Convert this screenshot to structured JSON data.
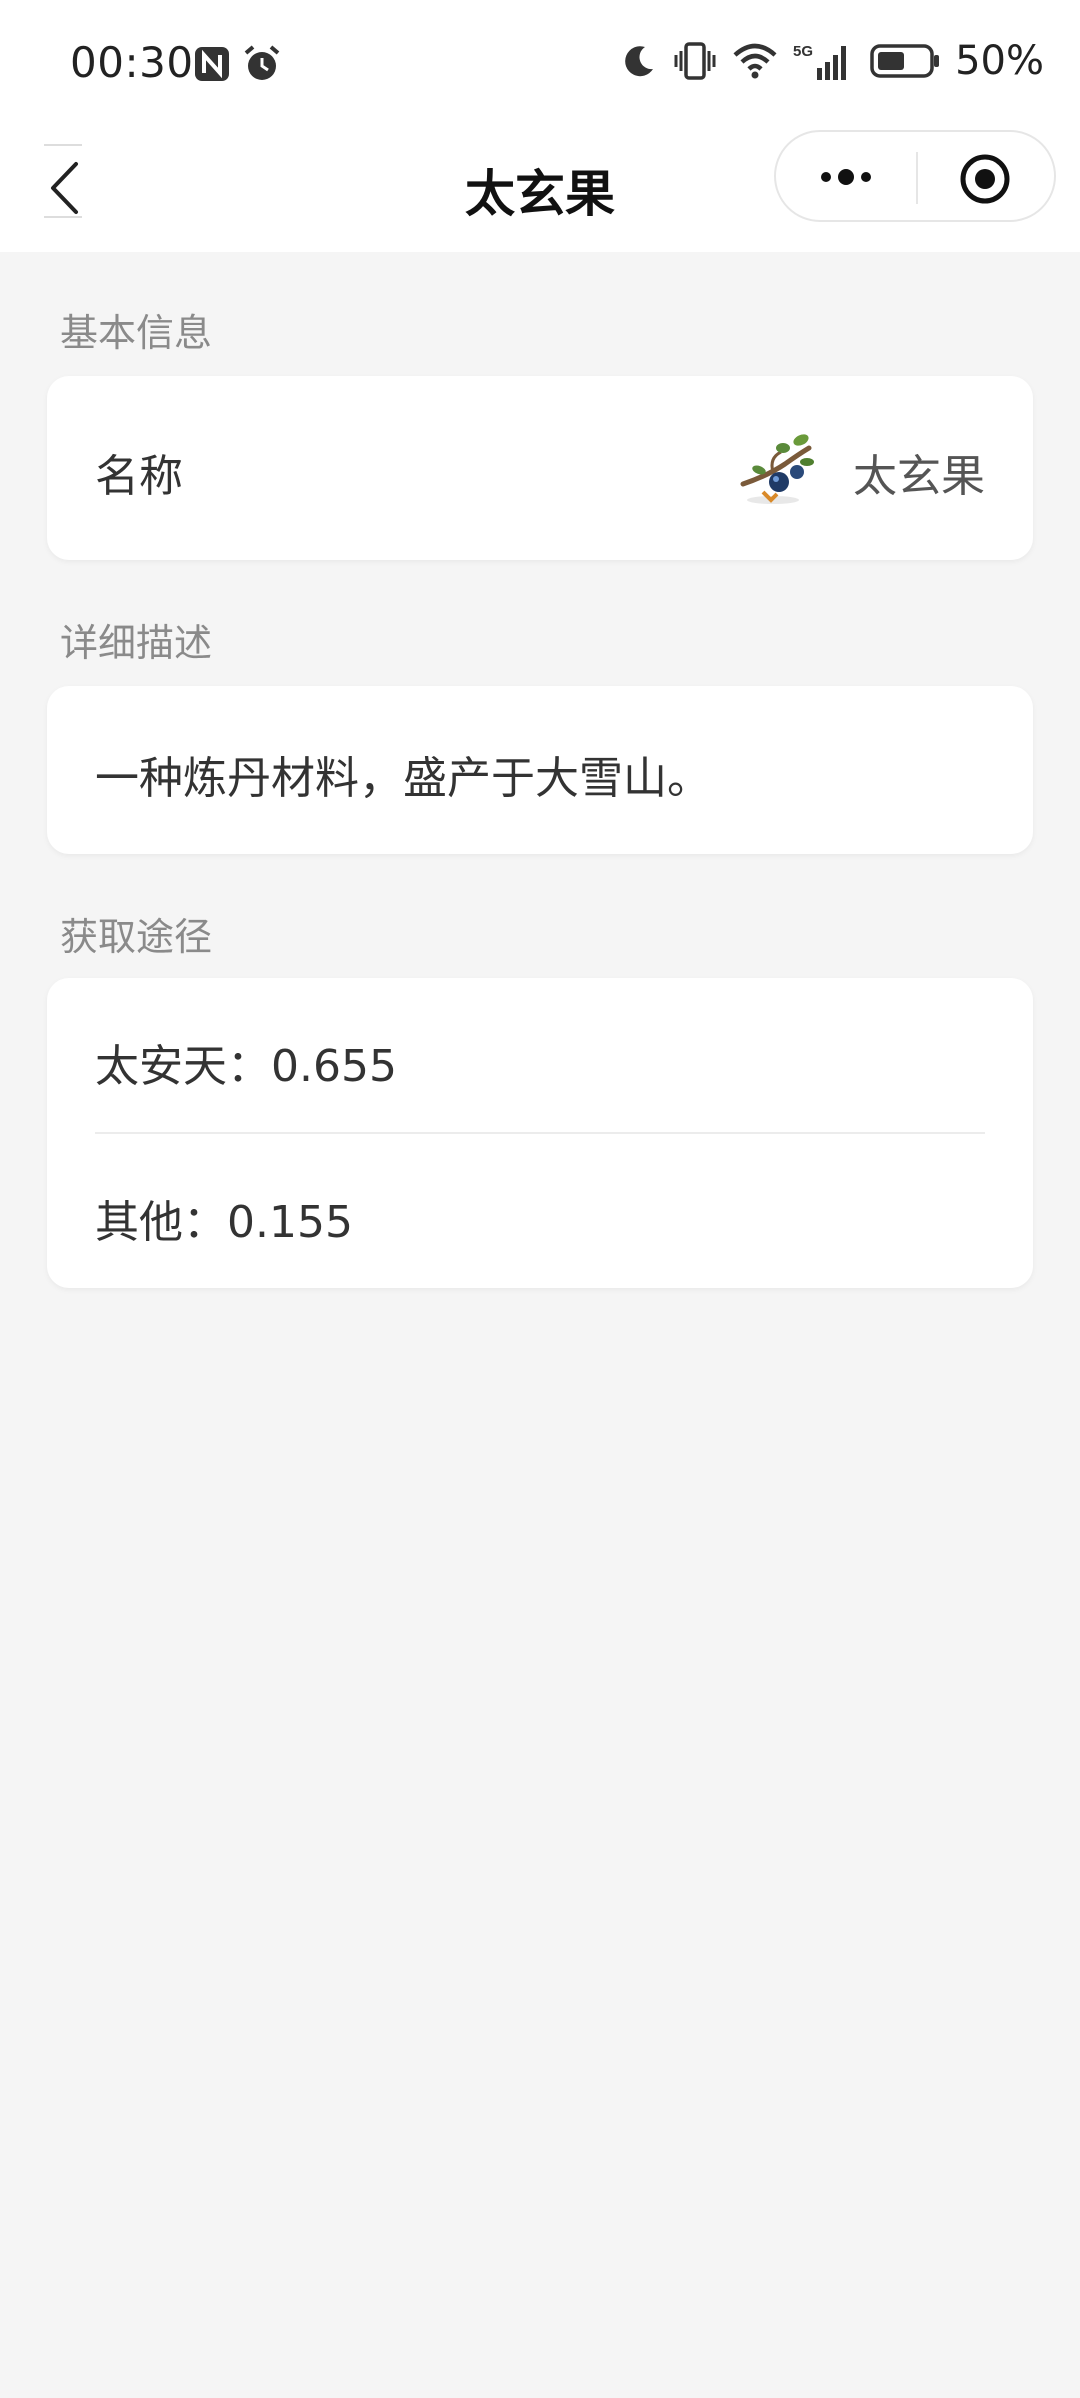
{
  "status_bar": {
    "time": "00:30",
    "battery_text": "50%",
    "network": "5G",
    "icons": [
      "nfc-icon",
      "alarm-icon",
      "moon-icon",
      "vibrate-icon",
      "wifi-icon",
      "signal-icon",
      "battery-icon"
    ]
  },
  "nav": {
    "title": "太玄果",
    "back_icon": "back-chevron-icon",
    "more_icon": "more-dots-icon",
    "close_icon": "target-close-icon"
  },
  "sections": {
    "basic": {
      "title": "基本信息",
      "name_label": "名称",
      "name_value": "太玄果",
      "item_icon": "fruit-branch-icon"
    },
    "description": {
      "title": "详细描述",
      "text": "一种炼丹材料，盛产于大雪山。"
    },
    "sources": {
      "title": "获取途径",
      "items": [
        {
          "label": "太安天：0.655"
        },
        {
          "label": "其他：0.155"
        }
      ]
    }
  },
  "colors": {
    "background": "#f5f5f5",
    "card": "#ffffff",
    "section_title": "#8a8a8a",
    "text": "#333333"
  }
}
